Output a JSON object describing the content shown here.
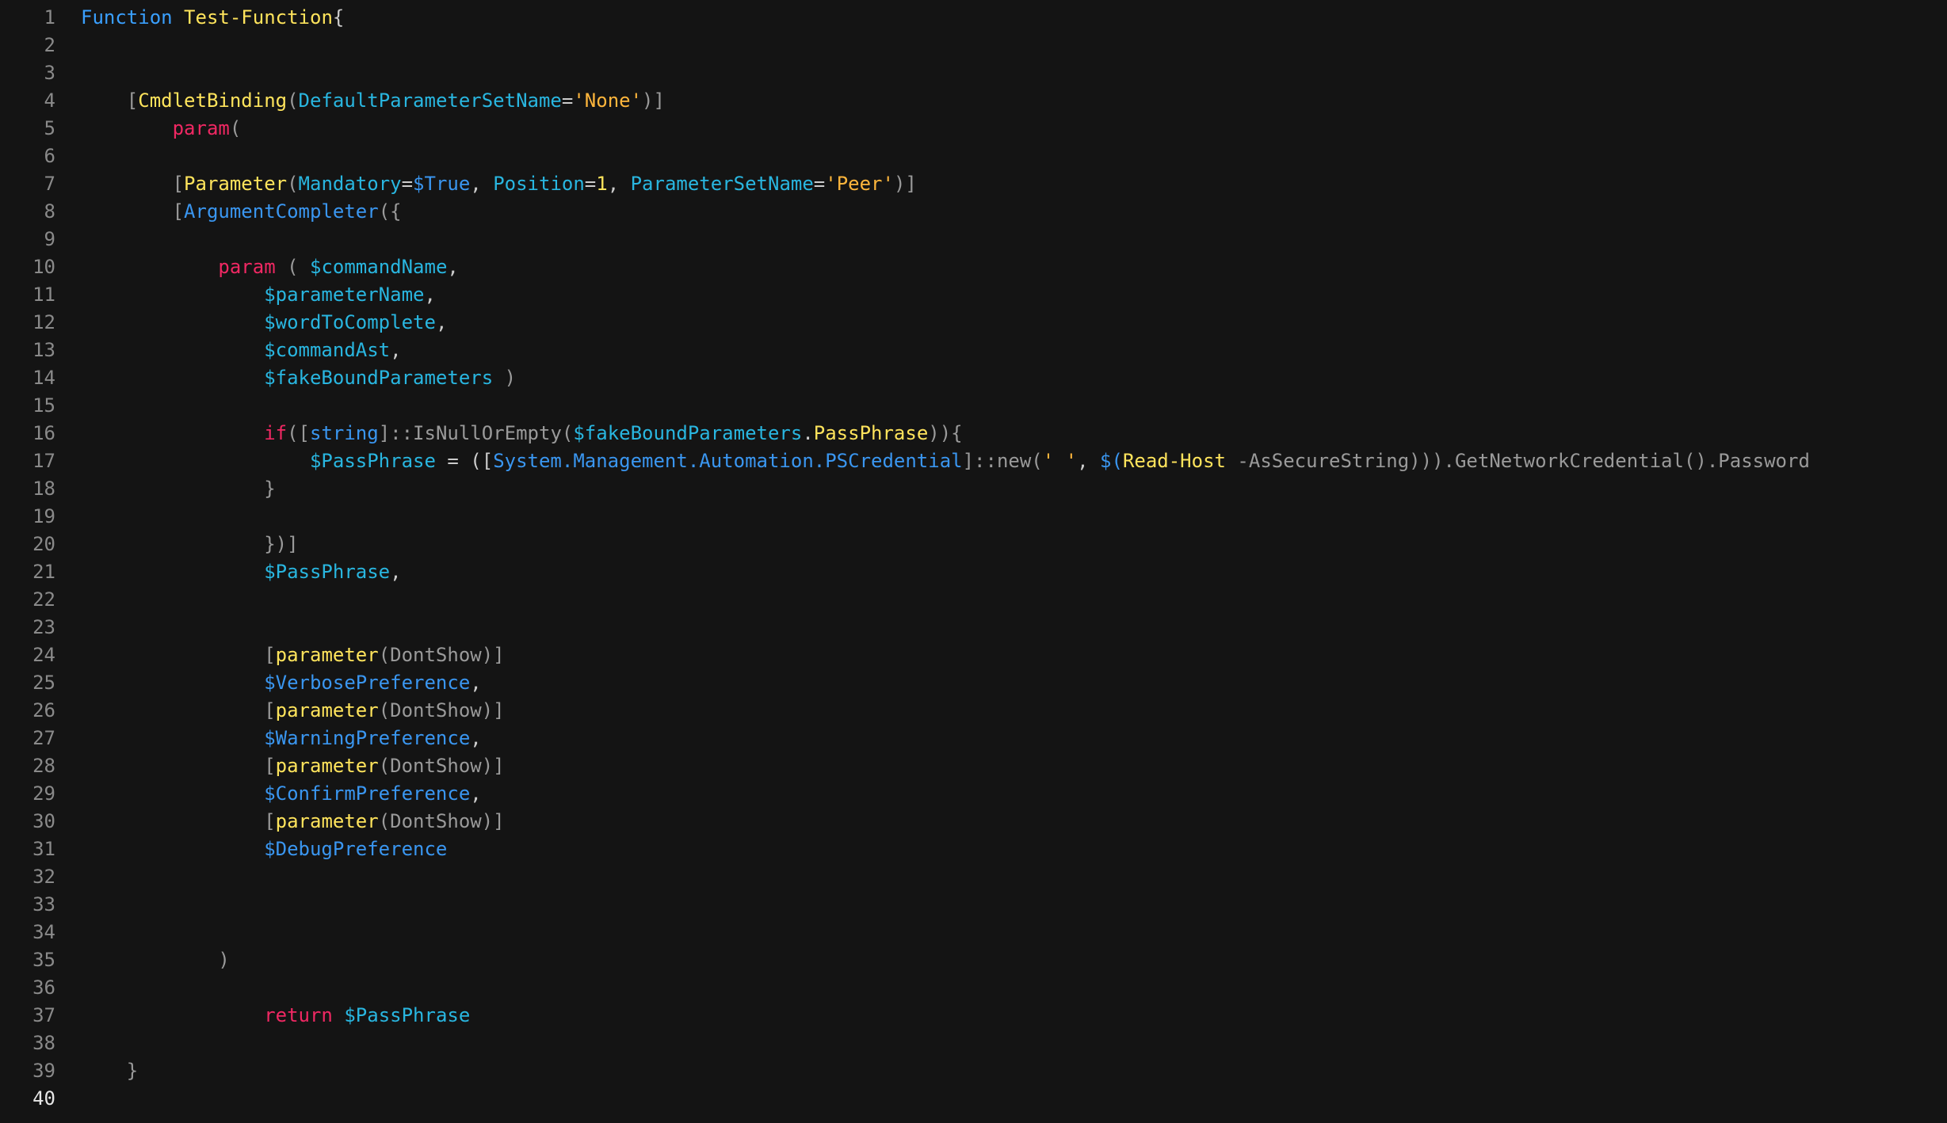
{
  "editor": {
    "lines": [
      {
        "n": "1",
        "tokens": [
          {
            "t": "Function",
            "c": "k-kw"
          },
          {
            "t": " ",
            "c": "k-punc"
          },
          {
            "t": "Test-Function",
            "c": "k-fn"
          },
          {
            "t": "{",
            "c": "k-punc"
          }
        ]
      },
      {
        "n": "2",
        "tokens": []
      },
      {
        "n": "3",
        "tokens": []
      },
      {
        "n": "4",
        "tokens": [
          {
            "t": "    [",
            "c": "k-bracket"
          },
          {
            "t": "CmdletBinding",
            "c": "k-fn"
          },
          {
            "t": "(",
            "c": "k-bracket"
          },
          {
            "t": "DefaultParameterSetName",
            "c": "k-attr"
          },
          {
            "t": "=",
            "c": "k-punc"
          },
          {
            "t": "'None'",
            "c": "k-str"
          },
          {
            "t": ")]",
            "c": "k-bracket"
          }
        ]
      },
      {
        "n": "5",
        "tokens": [
          {
            "t": "        ",
            "c": "k-punc"
          },
          {
            "t": "param",
            "c": "k-ctl"
          },
          {
            "t": "(",
            "c": "k-bracket"
          }
        ]
      },
      {
        "n": "6",
        "tokens": []
      },
      {
        "n": "7",
        "tokens": [
          {
            "t": "        [",
            "c": "k-bracket"
          },
          {
            "t": "Parameter",
            "c": "k-fn"
          },
          {
            "t": "(",
            "c": "k-bracket"
          },
          {
            "t": "Mandatory",
            "c": "k-attr"
          },
          {
            "t": "=",
            "c": "k-punc"
          },
          {
            "t": "$True",
            "c": "k-var2"
          },
          {
            "t": ", ",
            "c": "k-punc"
          },
          {
            "t": "Position",
            "c": "k-attr"
          },
          {
            "t": "=",
            "c": "k-punc"
          },
          {
            "t": "1",
            "c": "k-num"
          },
          {
            "t": ", ",
            "c": "k-punc"
          },
          {
            "t": "ParameterSetName",
            "c": "k-attr"
          },
          {
            "t": "=",
            "c": "k-punc"
          },
          {
            "t": "'Peer'",
            "c": "k-str"
          },
          {
            "t": ")]",
            "c": "k-bracket"
          }
        ]
      },
      {
        "n": "8",
        "tokens": [
          {
            "t": "        [",
            "c": "k-bracket"
          },
          {
            "t": "ArgumentCompleter",
            "c": "k-type"
          },
          {
            "t": "({",
            "c": "k-bracket"
          }
        ]
      },
      {
        "n": "9",
        "tokens": []
      },
      {
        "n": "10",
        "tokens": [
          {
            "t": "            ",
            "c": "k-punc"
          },
          {
            "t": "param",
            "c": "k-ctl"
          },
          {
            "t": " ( ",
            "c": "k-bracket"
          },
          {
            "t": "$commandName",
            "c": "k-var"
          },
          {
            "t": ",",
            "c": "k-punc"
          }
        ]
      },
      {
        "n": "11",
        "tokens": [
          {
            "t": "                ",
            "c": "k-punc"
          },
          {
            "t": "$parameterName",
            "c": "k-var"
          },
          {
            "t": ",",
            "c": "k-punc"
          }
        ]
      },
      {
        "n": "12",
        "tokens": [
          {
            "t": "                ",
            "c": "k-punc"
          },
          {
            "t": "$wordToComplete",
            "c": "k-var"
          },
          {
            "t": ",",
            "c": "k-punc"
          }
        ]
      },
      {
        "n": "13",
        "tokens": [
          {
            "t": "                ",
            "c": "k-punc"
          },
          {
            "t": "$commandAst",
            "c": "k-var"
          },
          {
            "t": ",",
            "c": "k-punc"
          }
        ]
      },
      {
        "n": "14",
        "tokens": [
          {
            "t": "                ",
            "c": "k-punc"
          },
          {
            "t": "$fakeBoundParameters",
            "c": "k-var"
          },
          {
            "t": " )",
            "c": "k-bracket"
          }
        ]
      },
      {
        "n": "15",
        "tokens": []
      },
      {
        "n": "16",
        "tokens": [
          {
            "t": "                ",
            "c": "k-punc"
          },
          {
            "t": "if",
            "c": "k-ctl"
          },
          {
            "t": "([",
            "c": "k-bracket"
          },
          {
            "t": "string",
            "c": "k-type"
          },
          {
            "t": "]::IsNullOrEmpty(",
            "c": "k-bracket"
          },
          {
            "t": "$fakeBoundParameters",
            "c": "k-var"
          },
          {
            "t": ".",
            "c": "k-punc"
          },
          {
            "t": "PassPhrase",
            "c": "k-fn"
          },
          {
            "t": ")){",
            "c": "k-bracket"
          }
        ]
      },
      {
        "n": "17",
        "tokens": [
          {
            "t": "                    ",
            "c": "k-punc"
          },
          {
            "t": "$PassPhrase",
            "c": "k-var"
          },
          {
            "t": " = ([",
            "c": "k-plain"
          },
          {
            "t": "System.Management.Automation.PSCredential",
            "c": "k-type"
          },
          {
            "t": "]::new(",
            "c": "k-bracket"
          },
          {
            "t": "' '",
            "c": "k-str"
          },
          {
            "t": ", ",
            "c": "k-punc"
          },
          {
            "t": "$(",
            "c": "k-var2"
          },
          {
            "t": "Read-Host",
            "c": "k-fn"
          },
          {
            "t": " -AsSecureString))).GetNetworkCredential().Password",
            "c": "k-param"
          }
        ]
      },
      {
        "n": "18",
        "tokens": [
          {
            "t": "                }",
            "c": "k-bracket"
          }
        ]
      },
      {
        "n": "19",
        "tokens": []
      },
      {
        "n": "20",
        "tokens": [
          {
            "t": "                })]",
            "c": "k-bracket"
          }
        ]
      },
      {
        "n": "21",
        "tokens": [
          {
            "t": "                ",
            "c": "k-punc"
          },
          {
            "t": "$PassPhrase",
            "c": "k-var"
          },
          {
            "t": ",",
            "c": "k-punc"
          }
        ]
      },
      {
        "n": "22",
        "tokens": []
      },
      {
        "n": "23",
        "tokens": []
      },
      {
        "n": "24",
        "tokens": [
          {
            "t": "                [",
            "c": "k-bracket"
          },
          {
            "t": "parameter",
            "c": "k-fn"
          },
          {
            "t": "(DontShow)]",
            "c": "k-bracket"
          }
        ]
      },
      {
        "n": "25",
        "tokens": [
          {
            "t": "                ",
            "c": "k-punc"
          },
          {
            "t": "$VerbosePreference",
            "c": "k-var2"
          },
          {
            "t": ",",
            "c": "k-punc"
          }
        ]
      },
      {
        "n": "26",
        "tokens": [
          {
            "t": "                [",
            "c": "k-bracket"
          },
          {
            "t": "parameter",
            "c": "k-fn"
          },
          {
            "t": "(DontShow)]",
            "c": "k-bracket"
          }
        ]
      },
      {
        "n": "27",
        "tokens": [
          {
            "t": "                ",
            "c": "k-punc"
          },
          {
            "t": "$WarningPreference",
            "c": "k-var2"
          },
          {
            "t": ",",
            "c": "k-punc"
          }
        ]
      },
      {
        "n": "28",
        "tokens": [
          {
            "t": "                [",
            "c": "k-bracket"
          },
          {
            "t": "parameter",
            "c": "k-fn"
          },
          {
            "t": "(DontShow)]",
            "c": "k-bracket"
          }
        ]
      },
      {
        "n": "29",
        "tokens": [
          {
            "t": "                ",
            "c": "k-punc"
          },
          {
            "t": "$ConfirmPreference",
            "c": "k-var2"
          },
          {
            "t": ",",
            "c": "k-punc"
          }
        ]
      },
      {
        "n": "30",
        "tokens": [
          {
            "t": "                [",
            "c": "k-bracket"
          },
          {
            "t": "parameter",
            "c": "k-fn"
          },
          {
            "t": "(DontShow)]",
            "c": "k-bracket"
          }
        ]
      },
      {
        "n": "31",
        "tokens": [
          {
            "t": "                ",
            "c": "k-punc"
          },
          {
            "t": "$DebugPreference",
            "c": "k-var2"
          }
        ]
      },
      {
        "n": "32",
        "tokens": []
      },
      {
        "n": "33",
        "tokens": []
      },
      {
        "n": "34",
        "tokens": []
      },
      {
        "n": "35",
        "tokens": [
          {
            "t": "            )",
            "c": "k-bracket"
          }
        ]
      },
      {
        "n": "36",
        "tokens": []
      },
      {
        "n": "37",
        "tokens": [
          {
            "t": "                ",
            "c": "k-punc"
          },
          {
            "t": "return",
            "c": "k-ctl"
          },
          {
            "t": " ",
            "c": "k-punc"
          },
          {
            "t": "$PassPhrase",
            "c": "k-var"
          }
        ]
      },
      {
        "n": "38",
        "tokens": []
      },
      {
        "n": "39",
        "tokens": [
          {
            "t": "    }",
            "c": "k-bracket"
          }
        ]
      },
      {
        "n": "40",
        "tokens": [],
        "active": true
      }
    ]
  }
}
